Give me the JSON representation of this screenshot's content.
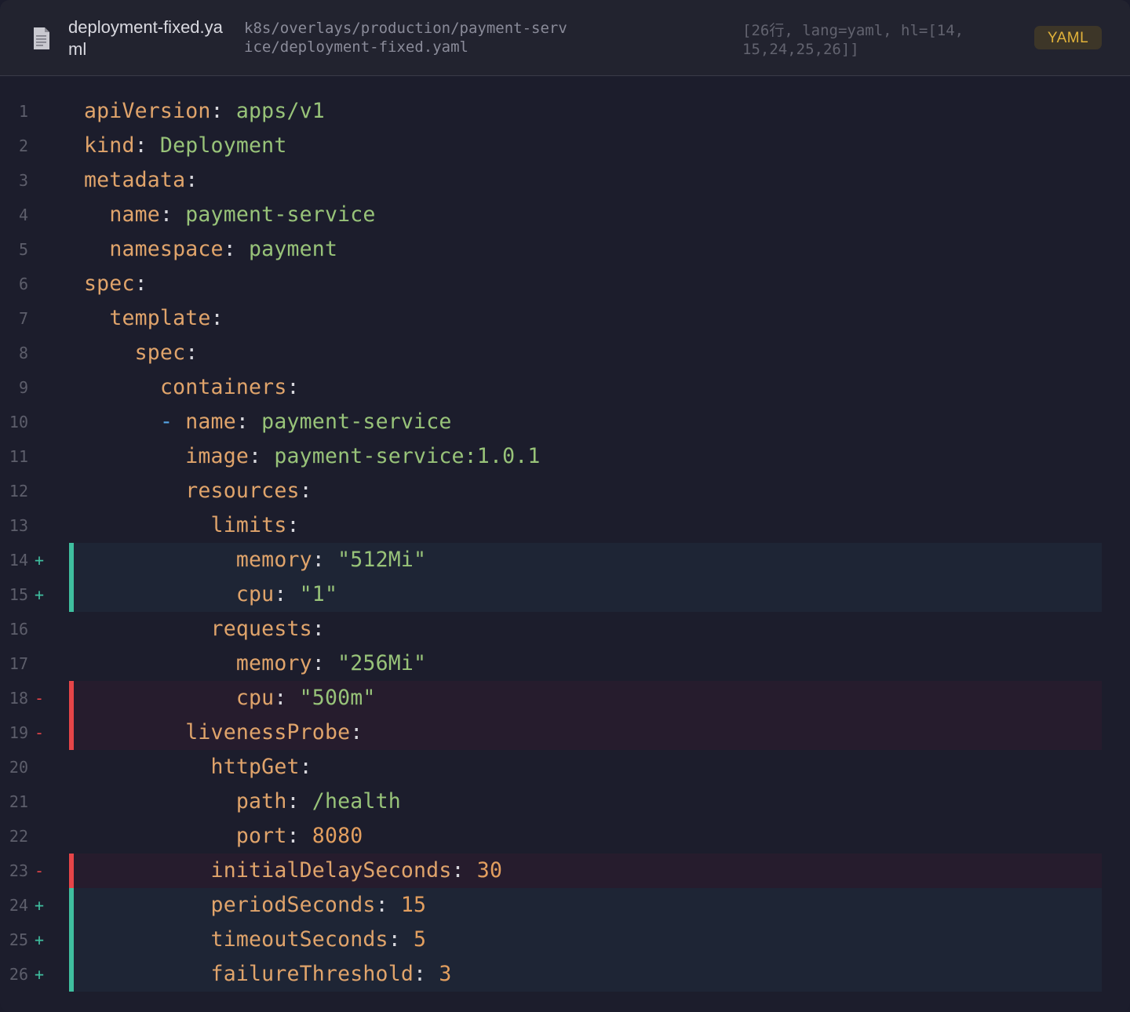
{
  "header": {
    "file_icon": "document-icon",
    "file_name": "deployment-fixed.yaml",
    "file_path": "k8s/overlays/production/payment-service/deployment-fixed.yaml",
    "meta": "[26行, lang=yaml, hl=[14,15,24,25,26]]",
    "lang_badge": "YAML"
  },
  "colors": {
    "background": "#1c1d2c",
    "added": "#3fbf9f",
    "removed": "#e64548",
    "key": "#e0a46b",
    "string": "#98c379",
    "number": "#e39f5f",
    "badge": "#e2b33a"
  },
  "lines": [
    {
      "n": "1",
      "mark": "",
      "type": "",
      "indent": "",
      "dash": "",
      "key": "apiVersion",
      "sep": ":",
      "val": " apps/v1",
      "vt": "v"
    },
    {
      "n": "2",
      "mark": "",
      "type": "",
      "indent": "",
      "dash": "",
      "key": "kind",
      "sep": ":",
      "val": " Deployment",
      "vt": "v"
    },
    {
      "n": "3",
      "mark": "",
      "type": "",
      "indent": "",
      "dash": "",
      "key": "metadata",
      "sep": ":",
      "val": "",
      "vt": "v"
    },
    {
      "n": "4",
      "mark": "",
      "type": "",
      "indent": "  ",
      "dash": "",
      "key": "name",
      "sep": ":",
      "val": " payment-service",
      "vt": "v"
    },
    {
      "n": "5",
      "mark": "",
      "type": "",
      "indent": "  ",
      "dash": "",
      "key": "namespace",
      "sep": ":",
      "val": " payment",
      "vt": "v"
    },
    {
      "n": "6",
      "mark": "",
      "type": "",
      "indent": "",
      "dash": "",
      "key": "spec",
      "sep": ":",
      "val": "",
      "vt": "v"
    },
    {
      "n": "7",
      "mark": "",
      "type": "",
      "indent": "  ",
      "dash": "",
      "key": "template",
      "sep": ":",
      "val": "",
      "vt": "v"
    },
    {
      "n": "8",
      "mark": "",
      "type": "",
      "indent": "    ",
      "dash": "",
      "key": "spec",
      "sep": ":",
      "val": "",
      "vt": "v"
    },
    {
      "n": "9",
      "mark": "",
      "type": "",
      "indent": "      ",
      "dash": "",
      "key": "containers",
      "sep": ":",
      "val": "",
      "vt": "v"
    },
    {
      "n": "10",
      "mark": "",
      "type": "",
      "indent": "      ",
      "dash": "- ",
      "key": "name",
      "sep": ":",
      "val": " payment-service",
      "vt": "v"
    },
    {
      "n": "11",
      "mark": "",
      "type": "",
      "indent": "        ",
      "dash": "",
      "key": "image",
      "sep": ":",
      "val": " payment-service:1.0.1",
      "vt": "v"
    },
    {
      "n": "12",
      "mark": "",
      "type": "",
      "indent": "        ",
      "dash": "",
      "key": "resources",
      "sep": ":",
      "val": "",
      "vt": "v"
    },
    {
      "n": "13",
      "mark": "",
      "type": "",
      "indent": "          ",
      "dash": "",
      "key": "limits",
      "sep": ":",
      "val": "",
      "vt": "v"
    },
    {
      "n": "14",
      "mark": "+",
      "type": "add",
      "indent": "            ",
      "dash": "",
      "key": "memory",
      "sep": ":",
      "val": " \"512Mi\"",
      "vt": "v"
    },
    {
      "n": "15",
      "mark": "+",
      "type": "add",
      "indent": "            ",
      "dash": "",
      "key": "cpu",
      "sep": ":",
      "val": " \"1\"",
      "vt": "v"
    },
    {
      "n": "16",
      "mark": "",
      "type": "",
      "indent": "          ",
      "dash": "",
      "key": "requests",
      "sep": ":",
      "val": "",
      "vt": "v"
    },
    {
      "n": "17",
      "mark": "",
      "type": "",
      "indent": "            ",
      "dash": "",
      "key": "memory",
      "sep": ":",
      "val": " \"256Mi\"",
      "vt": "v"
    },
    {
      "n": "18",
      "mark": "-",
      "type": "del",
      "indent": "            ",
      "dash": "",
      "key": "cpu",
      "sep": ":",
      "val": " \"500m\"",
      "vt": "v"
    },
    {
      "n": "19",
      "mark": "-",
      "type": "del",
      "indent": "        ",
      "dash": "",
      "key": "livenessProbe",
      "sep": ":",
      "val": "",
      "vt": "v"
    },
    {
      "n": "20",
      "mark": "",
      "type": "",
      "indent": "          ",
      "dash": "",
      "key": "httpGet",
      "sep": ":",
      "val": "",
      "vt": "v"
    },
    {
      "n": "21",
      "mark": "",
      "type": "",
      "indent": "            ",
      "dash": "",
      "key": "path",
      "sep": ":",
      "val": " /health",
      "vt": "v"
    },
    {
      "n": "22",
      "mark": "",
      "type": "",
      "indent": "            ",
      "dash": "",
      "key": "port",
      "sep": ":",
      "val": " 8080",
      "vt": "n"
    },
    {
      "n": "23",
      "mark": "-",
      "type": "del",
      "indent": "          ",
      "dash": "",
      "key": "initialDelaySeconds",
      "sep": ":",
      "val": " 30",
      "vt": "n"
    },
    {
      "n": "24",
      "mark": "+",
      "type": "add",
      "indent": "          ",
      "dash": "",
      "key": "periodSeconds",
      "sep": ":",
      "val": " 15",
      "vt": "n"
    },
    {
      "n": "25",
      "mark": "+",
      "type": "add",
      "indent": "          ",
      "dash": "",
      "key": "timeoutSeconds",
      "sep": ":",
      "val": " 5",
      "vt": "n"
    },
    {
      "n": "26",
      "mark": "+",
      "type": "add",
      "indent": "          ",
      "dash": "",
      "key": "failureThreshold",
      "sep": ":",
      "val": " 3",
      "vt": "n"
    }
  ]
}
